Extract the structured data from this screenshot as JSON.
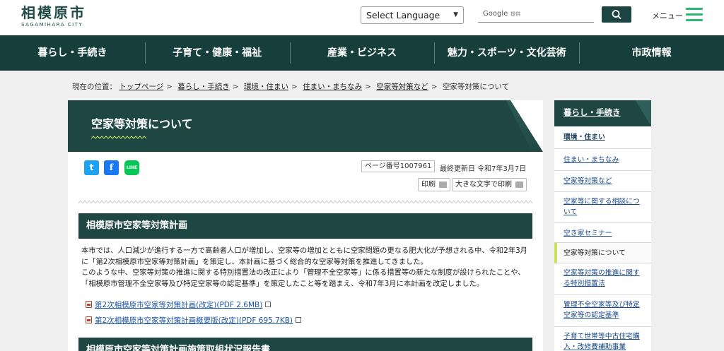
{
  "header": {
    "logo_main": "相模原市",
    "logo_sub": "SAGAMIHARA CITY",
    "language_select": "Select Language",
    "search_google": "Google",
    "search_provided": "提供",
    "menu_label": "メニュー"
  },
  "nav": {
    "items": [
      "暮らし・手続き",
      "子育て・健康・福祉",
      "産業・ビジネス",
      "魅力・スポーツ・文化芸術",
      "市政情報"
    ]
  },
  "breadcrumb": {
    "prefix": "現在の位置：",
    "links": [
      "トップページ",
      "暮らし・手続き",
      "環境・住まい",
      "住まい・まちなみ",
      "空家等対策など"
    ],
    "current": "空家等対策について"
  },
  "page": {
    "title": "空家等対策について",
    "page_number": "ページ番号1007961",
    "updated": "最終更新日 令和7年3月7日",
    "print": "印刷",
    "print_large": "大きな文字で印刷",
    "social": {
      "twitter": "t",
      "facebook": "f",
      "line": "LINE"
    }
  },
  "section1": {
    "heading": "相模原市空家等対策計画",
    "paragraph1": "本市では、人口減少が進行する一方で高齢者人口が増加し、空家等の増加とともに空家問題の更なる肥大化が予想される中、令和2年3月に「第2次相模原市空家等対策計画」を策定し、本計画に基づく総合的な空家等対策を推進してきました。",
    "paragraph2": "このような中、空家等対策の推進に関する特別措置法の改正により「管理不全空家等」に係る措置等の新たな制度が設けられたことや、「相模原市管理不全空家等及び特定空家等の認定基準」を策定したこと等を踏まえ、令和7年3月に本計画を改定しました。",
    "links": [
      "第2次相模原市空家等対策計画(改定)(PDF 2.6MB)",
      "第2次相模原市空家等対策計画概要版(改定)(PDF 695.7KB)"
    ]
  },
  "section2": {
    "heading": "相模原市空家等対策計画施策取組状況報告書"
  },
  "sidebar": {
    "heading": "暮らし・手続き",
    "items": [
      "環境・住まい",
      "住まい・まちなみ",
      "空家等対策など",
      "空家等に関する相談について",
      "空き家セミナー",
      "空家等対策について",
      "空家等対策の推進に関する特別措置法",
      "管理不全空家等及び特定空家等の認定基準",
      "子育て世帯等中古住宅購入・改修費補助事業"
    ]
  },
  "colors": {
    "primary": "#1e4744",
    "accent": "#2bb673",
    "link": "#1a56a8",
    "current_marker": "#c8e25a"
  }
}
